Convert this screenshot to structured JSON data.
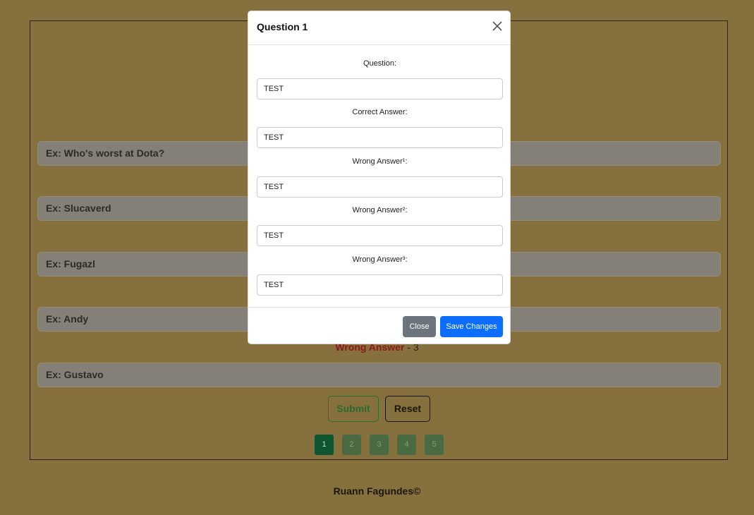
{
  "form": {
    "fields": [
      {
        "placeholder": "Ex: Who's worst at Dota?"
      },
      {
        "placeholder": "Ex: Slucaverd"
      },
      {
        "placeholder": "Ex: Fugazl"
      },
      {
        "placeholder": "Ex: Andy"
      },
      {
        "placeholder": "Ex: Gustavo"
      }
    ],
    "wrong_label": "Wrong Answer",
    "wrong_count": " - 3",
    "submit_label": "Submit",
    "reset_label": "Reset"
  },
  "pagination": {
    "pages": [
      "1",
      "2",
      "3",
      "4",
      "5"
    ],
    "active": "1"
  },
  "footer": {
    "text": "Ruann Fagundes©"
  },
  "modal": {
    "title": "Question 1",
    "close_icon": "close-icon",
    "fields": [
      {
        "label": "Question:",
        "value": "TEST"
      },
      {
        "label": "Correct Answer:",
        "value": "TEST"
      },
      {
        "label": "Wrong Answer¹:",
        "value": "TEST"
      },
      {
        "label": "Wrong Answer²:",
        "value": "TEST"
      },
      {
        "label": "Wrong Answer³:",
        "value": "TEST"
      }
    ],
    "close_label": "Close",
    "save_label": "Save Changes"
  },
  "colors": {
    "background": "#85703e",
    "primary": "#0d6efd",
    "secondary": "#6c757d",
    "wrong": "#8c1a1a",
    "submit": "#2a6b2e"
  }
}
